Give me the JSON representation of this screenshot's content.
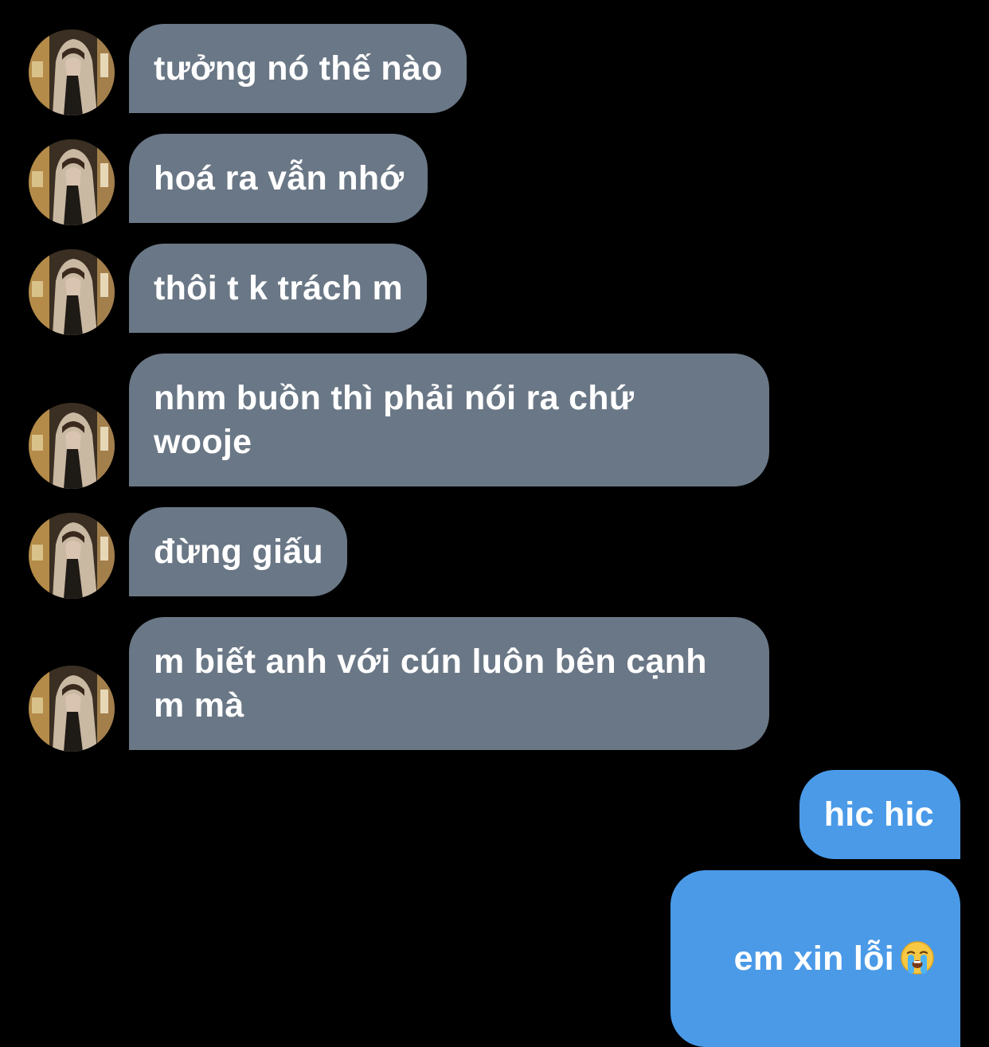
{
  "conversation": {
    "incoming": [
      {
        "text": "tưởng nó thế nào"
      },
      {
        "text": "hoá ra vẫn nhớ"
      },
      {
        "text": "thôi t k trách m"
      },
      {
        "text": "nhm buồn thì phải nói ra chứ\nwooje"
      },
      {
        "text": "đừng giấu"
      },
      {
        "text": "m biết anh với cún luôn bên cạnh\nm mà"
      }
    ],
    "outgoing": [
      {
        "text": "hic hic"
      },
      {
        "text": "em xin lỗi",
        "emoji": "loudly-crying-face"
      }
    ]
  },
  "colors": {
    "background": "#000000",
    "incoming_bubble": "#6a7786",
    "outgoing_bubble": "#4a9ae8",
    "text": "#ffffff"
  }
}
